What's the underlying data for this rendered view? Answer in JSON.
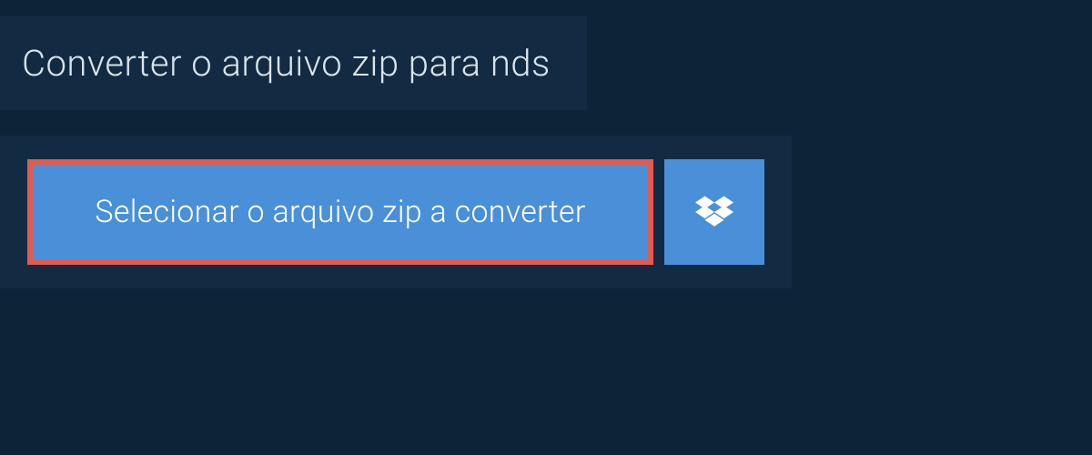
{
  "title": "Converter o arquivo zip para nds",
  "select_button_label": "Selecionar o arquivo zip a converter",
  "colors": {
    "background": "#0d2438",
    "panel": "#122b42",
    "button": "#4a90d9",
    "highlight_border": "#e35a4f",
    "text_light": "#d9e4ec",
    "white": "#ffffff"
  }
}
